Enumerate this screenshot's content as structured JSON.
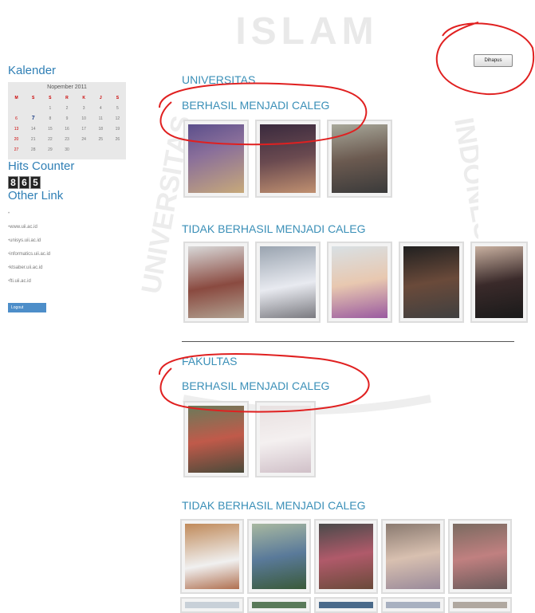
{
  "watermark": {
    "text": "ISLAM INDONESIA UNIVERSITAS"
  },
  "sidebar": {
    "calendar_heading": "Kalender",
    "calendar": {
      "month": "Nopember 2011",
      "weekdays": [
        "M",
        "S",
        "S",
        "R",
        "K",
        "J",
        "S"
      ],
      "weeks": [
        [
          "",
          "",
          "1",
          "2",
          "3",
          "4",
          "5"
        ],
        [
          "6",
          "7",
          "8",
          "9",
          "10",
          "11",
          "12"
        ],
        [
          "13",
          "14",
          "15",
          "16",
          "17",
          "18",
          "19"
        ],
        [
          "20",
          "21",
          "22",
          "23",
          "24",
          "25",
          "26"
        ],
        [
          "27",
          "28",
          "29",
          "30",
          "",
          "",
          ""
        ]
      ],
      "today": "7"
    },
    "hits_heading": "Hits Counter",
    "hits_digits": [
      "8",
      "6",
      "5"
    ],
    "other_link_heading": "Other Link",
    "links": [
      "",
      "www.uii.ac.id",
      "unisys.uii.ac.id",
      "informatics.uii.ac.id",
      "ktsaber.uii.ac.id",
      "fti.uii.ac.id"
    ],
    "logout_label": "Logout"
  },
  "toolbar": {
    "delete_label": "Dihapus"
  },
  "sections": {
    "universitas": "UNIVERSITAS",
    "univ_success": "BERHASIL MENJADI CALEG",
    "univ_fail": "TIDAK BERHASIL MENJADI CALEG",
    "fakultas": "FAKULTAS",
    "fak_success": "BERHASIL MENJADI CALEG",
    "fak_fail": "TIDAK BERHASIL MENJADI CALEG"
  },
  "colors": {
    "accent": "#3a8fb7",
    "annotation": "#e02020",
    "logout": "#4d8ec9"
  }
}
